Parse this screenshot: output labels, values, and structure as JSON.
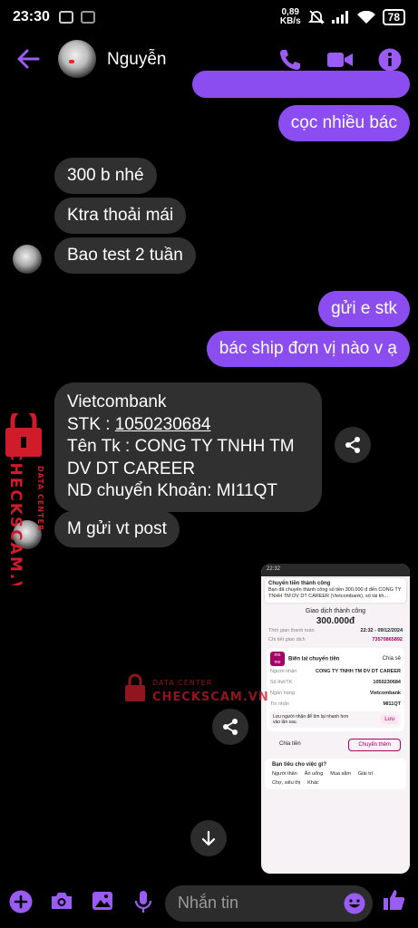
{
  "status_bar": {
    "time": "23:30",
    "net_speed_value": "0,89",
    "net_speed_unit": "KB/s",
    "battery": "78"
  },
  "header": {
    "contact_name": "Nguyễn",
    "icons": [
      "back-arrow-icon",
      "phone-icon",
      "video-icon",
      "info-icon"
    ],
    "accent_color": "#9b5cf6"
  },
  "messages": [
    {
      "from": "me",
      "text": "cọc nhiều bác"
    },
    {
      "from": "them",
      "text": "300 b nhé"
    },
    {
      "from": "them",
      "text": "Ktra thoải mái"
    },
    {
      "from": "them",
      "text": "Bao test 2 tuần"
    },
    {
      "from": "me",
      "text": "gửi e stk"
    },
    {
      "from": "me",
      "text": "bác ship đơn vị nào v ạ"
    },
    {
      "from": "them",
      "bank": {
        "line1": "Vietcombank",
        "stk_label": "STK : ",
        "stk_number": "1050230684",
        "line3": "Tên Tk : CONG TY TNHH TM DV DT CAREER",
        "line4": "ND chuyển Khoản: MI11QT"
      }
    },
    {
      "from": "them",
      "text": "M gửi vt post"
    }
  ],
  "bubble_colors": {
    "incoming": "#303030",
    "outgoing": "#8c4df0"
  },
  "screenshot_preview": {
    "time": "22:32",
    "notif_title": "Chuyển tiền thành công",
    "notif_body": "Bạn đã chuyển thành công số tiền 300.000 đ đến CONG TY TNHH TM DV DT CAREER (Vietcombank), số tài kh...",
    "status": "Giao dịch thành công",
    "amount": "300.000đ",
    "rows": [
      {
        "label": "Thời gian thanh toán",
        "value": "22:32 - 09/12/2024"
      },
      {
        "label": "Chi tiết giao dịch",
        "value": "73570865892"
      }
    ],
    "receipt_title": "Biên lai chuyển tiền",
    "share_label": "Chia sẻ",
    "details": [
      {
        "label": "Người nhận",
        "value": "CONG TY TNHH TM DV DT CAREER"
      },
      {
        "label": "Số thẻ/TK",
        "value": "1050230684"
      },
      {
        "label": "Ngân hàng",
        "value": "Vietcombank"
      },
      {
        "label": "Tin nhắn",
        "value": "MI11QT"
      }
    ],
    "save_hint": "Lưu người nhận để tìm lại nhanh hơn vào lần sau.",
    "save_button": "Lưu",
    "button_split": "Chia tiền",
    "button_more": "Chuyển thêm",
    "question": "Bạn tiêu cho việc gì?",
    "categories": [
      "Người thân",
      "Ăn uống",
      "Mua sắm",
      "Giải trí",
      "Chợ, siêu thị",
      "Khác"
    ]
  },
  "watermark": {
    "top": "DATA CENTER",
    "brand": "CHECKSCAM.VN"
  },
  "composer": {
    "placeholder": "Nhắn tin",
    "icons": [
      "plus-icon",
      "camera-icon",
      "gallery-icon",
      "mic-icon",
      "emoji-icon",
      "thumbs-up-icon"
    ]
  }
}
